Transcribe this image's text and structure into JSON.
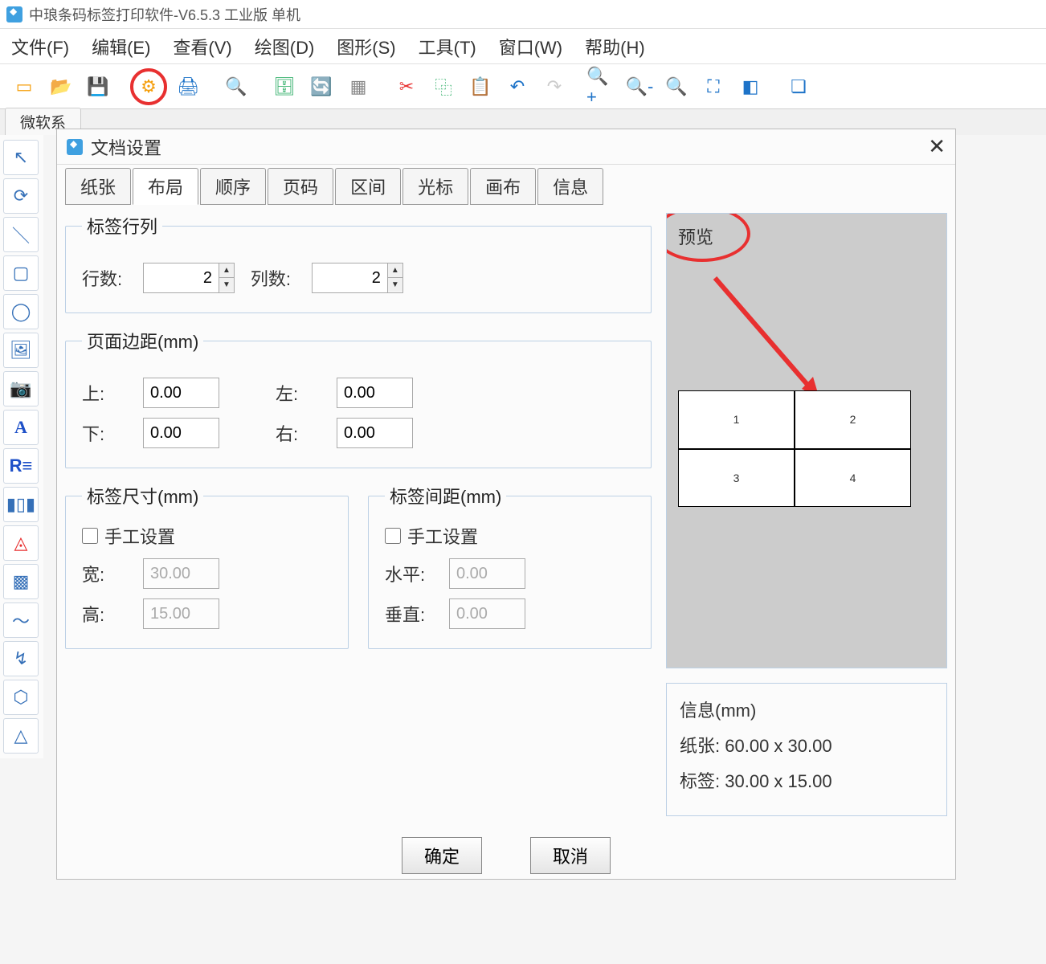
{
  "titlebar": "中琅条码标签打印软件-V6.5.3 工业版 单机",
  "menu": [
    "文件(F)",
    "编辑(E)",
    "查看(V)",
    "绘图(D)",
    "图形(S)",
    "工具(T)",
    "窗口(W)",
    "帮助(H)"
  ],
  "tab_header": "微软系",
  "dialog": {
    "title": "文档设置",
    "tabs": [
      "纸张",
      "布局",
      "顺序",
      "页码",
      "区间",
      "光标",
      "画布",
      "信息"
    ],
    "active_tab": "布局",
    "rowcol": {
      "legend": "标签行列",
      "rows_label": "行数:",
      "rows_value": "2",
      "cols_label": "列数:",
      "cols_value": "2"
    },
    "margins": {
      "legend": "页面边距(mm)",
      "top_label": "上:",
      "top_value": "0.00",
      "left_label": "左:",
      "left_value": "0.00",
      "bottom_label": "下:",
      "bottom_value": "0.00",
      "right_label": "右:",
      "right_value": "0.00"
    },
    "size": {
      "legend": "标签尺寸(mm)",
      "manual": "手工设置",
      "width_label": "宽:",
      "width_value": "30.00",
      "height_label": "高:",
      "height_value": "15.00"
    },
    "gap": {
      "legend": "标签间距(mm)",
      "manual": "手工设置",
      "h_label": "水平:",
      "h_value": "0.00",
      "v_label": "垂直:",
      "v_value": "0.00"
    },
    "preview_label": "预览",
    "preview_cells": [
      "1",
      "2",
      "3",
      "4"
    ],
    "info": {
      "legend": "信息(mm)",
      "paper_label": "纸张:",
      "paper_value": "60.00 x 30.00",
      "label_label": "标签:",
      "label_value": "30.00 x 15.00"
    },
    "ok": "确定",
    "cancel": "取消"
  }
}
